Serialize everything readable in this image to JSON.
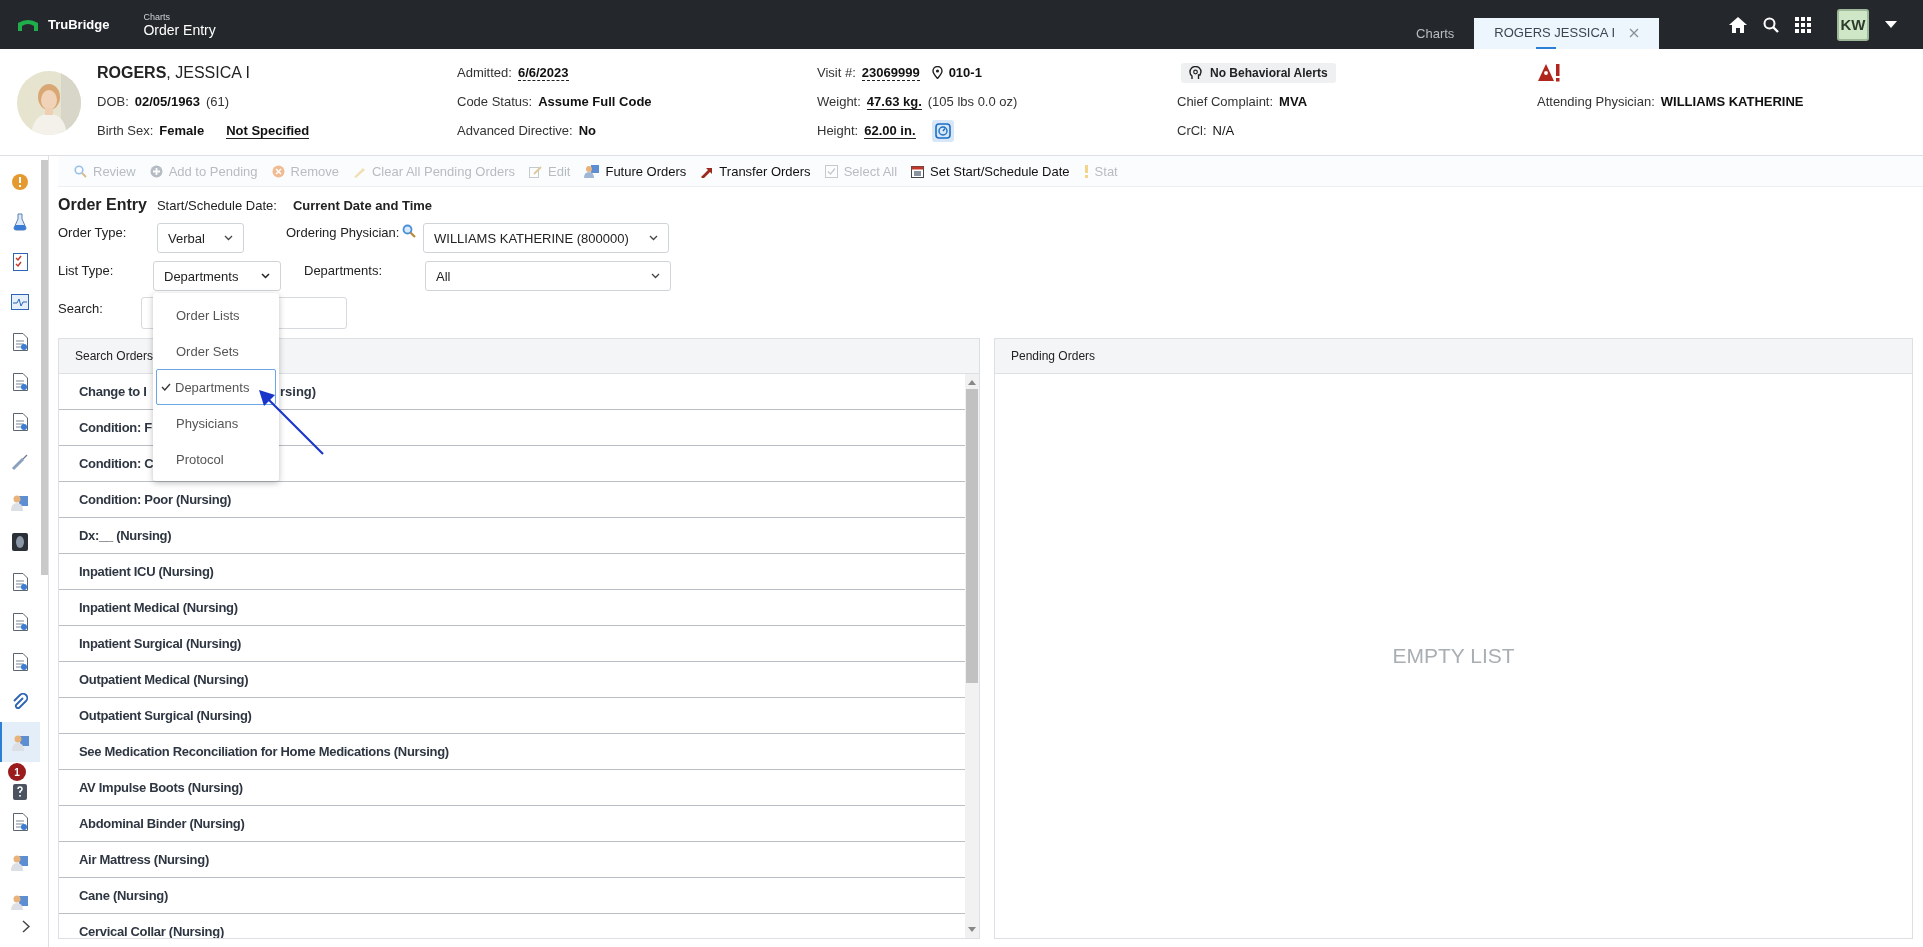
{
  "app_bar": {
    "brand": "TruBridge",
    "breadcrumb": "Charts",
    "title": "Order Entry",
    "tabs": [
      {
        "label": "Charts",
        "selected": false,
        "closable": false
      },
      {
        "label": "ROGERS JESSICA I",
        "selected": true,
        "closable": true
      }
    ],
    "avatar": "KW"
  },
  "banner": {
    "columns": [
      [
        {
          "kind": "name",
          "text": "**ROGERS**, JESSICA I"
        },
        {
          "kind": "field",
          "label": "DOB:",
          "value": "02/05/1963",
          "bold": true,
          "note": "(61)"
        },
        {
          "kind": "field",
          "label": "Birth Sex:",
          "value": "Female",
          "bold": true,
          "link": "Not Specified"
        }
      ],
      [
        {
          "kind": "field",
          "label": "Admitted:",
          "value": "6/6/2023",
          "bold": true,
          "dashed": true
        },
        {
          "kind": "field",
          "label": "Code Status:",
          "value": "Assume Full Code",
          "bold": true
        },
        {
          "kind": "field",
          "label": "Advanced Directive:",
          "value": "No",
          "bold": true
        }
      ],
      [
        {
          "kind": "field",
          "label": "Visit #:",
          "value": "23069999",
          "bold": true,
          "dashed": true,
          "location": "010-1"
        },
        {
          "kind": "field",
          "label": "Weight:",
          "value": "47.63 kg.",
          "bold": true,
          "underlined": true,
          "note": "(105 lbs 0.0 oz)"
        },
        {
          "kind": "field",
          "label": "Height:",
          "value": "62.00 in.",
          "bold": true,
          "underlined": true,
          "calculator": true
        }
      ],
      [
        {
          "kind": "chip",
          "text": "No Behavioral Alerts"
        },
        {
          "kind": "field",
          "label": "Chief Complaint:",
          "value": "MVA",
          "bold": true
        },
        {
          "kind": "field",
          "label": "CrCl:",
          "value": "N/A",
          "bold": false
        }
      ],
      [
        {
          "kind": "alert"
        },
        {
          "kind": "field",
          "label": "Attending Physician:",
          "value": "WILLIAMS KATHERINE",
          "bold": true
        }
      ]
    ]
  },
  "sidebar": {
    "items": [
      {
        "selected": false
      },
      {
        "selected": false
      },
      {
        "selected": false
      },
      {
        "selected": false
      },
      {
        "selected": false
      },
      {
        "selected": false
      },
      {
        "selected": false
      },
      {
        "selected": false
      },
      {
        "selected": false
      },
      {
        "selected": false
      },
      {
        "selected": false
      },
      {
        "selected": false
      },
      {
        "selected": false
      },
      {
        "selected": false
      },
      {
        "selected": true
      },
      {
        "selected": false,
        "badge": "1"
      },
      {
        "selected": false
      },
      {
        "selected": false
      },
      {
        "selected": false
      }
    ]
  },
  "toolbar": [
    {
      "label": "Review",
      "disabled": true
    },
    {
      "label": "Add to Pending",
      "disabled": true
    },
    {
      "label": "Remove",
      "disabled": true
    },
    {
      "label": "Clear All Pending Orders",
      "disabled": true
    },
    {
      "label": "Edit",
      "disabled": true
    },
    {
      "label": "Future Orders",
      "disabled": false
    },
    {
      "label": "Transfer Orders",
      "disabled": false
    },
    {
      "label": "Select All",
      "disabled": true
    },
    {
      "label": "Set Start/Schedule Date",
      "disabled": false
    },
    {
      "label": "Stat",
      "disabled": true
    }
  ],
  "order_entry": {
    "title": "Order Entry",
    "start_date": {
      "label": "Start/Schedule Date:",
      "value": "Current Date and Time"
    },
    "order_type": {
      "label": "Order Type:",
      "value": "Verbal"
    },
    "ordering_physician": {
      "label": "Ordering Physician:",
      "value": "WILLIAMS KATHERINE (800000)"
    },
    "list_type": {
      "label": "List Type:",
      "value": "Departments",
      "menu": [
        {
          "label": "Order Lists",
          "selected": false
        },
        {
          "label": "Order Sets",
          "selected": false
        },
        {
          "label": "Departments",
          "selected": true
        },
        {
          "label": "Physicians",
          "selected": false
        },
        {
          "label": "Protocol",
          "selected": false
        }
      ]
    },
    "departments": {
      "label": "Departments:",
      "value": "All"
    },
    "search": {
      "label": "Search:"
    }
  },
  "search_orders": {
    "title": "Search Orders",
    "rows": [
      {
        "parts": [
          "Change to I",
          "rsing)"
        ]
      },
      {
        "parts": [
          "Condition: F"
        ]
      },
      {
        "parts": [
          "Condition: C"
        ]
      },
      {
        "parts": [
          "Condition: Poor (Nursing)"
        ]
      },
      {
        "parts": [
          "Dx:__ (Nursing)"
        ]
      },
      {
        "parts": [
          "Inpatient ICU (Nursing)"
        ]
      },
      {
        "parts": [
          "Inpatient Medical (Nursing)"
        ]
      },
      {
        "parts": [
          "Inpatient Surgical (Nursing)"
        ]
      },
      {
        "parts": [
          "Outpatient Medical (Nursing)"
        ]
      },
      {
        "parts": [
          "Outpatient Surgical (Nursing)"
        ]
      },
      {
        "parts": [
          "See Medication Reconciliation for Home Medications (Nursing)"
        ]
      },
      {
        "parts": [
          "AV Impulse Boots (Nursing)"
        ]
      },
      {
        "parts": [
          "Abdominal Binder (Nursing)"
        ]
      },
      {
        "parts": [
          "Air Mattress (Nursing)"
        ]
      },
      {
        "parts": [
          "Cane (Nursing)"
        ]
      },
      {
        "parts": [
          "Cervical Collar (Nursing)"
        ]
      }
    ]
  },
  "pending_orders": {
    "title": "Pending Orders",
    "empty_text": "EMPTY LIST"
  }
}
